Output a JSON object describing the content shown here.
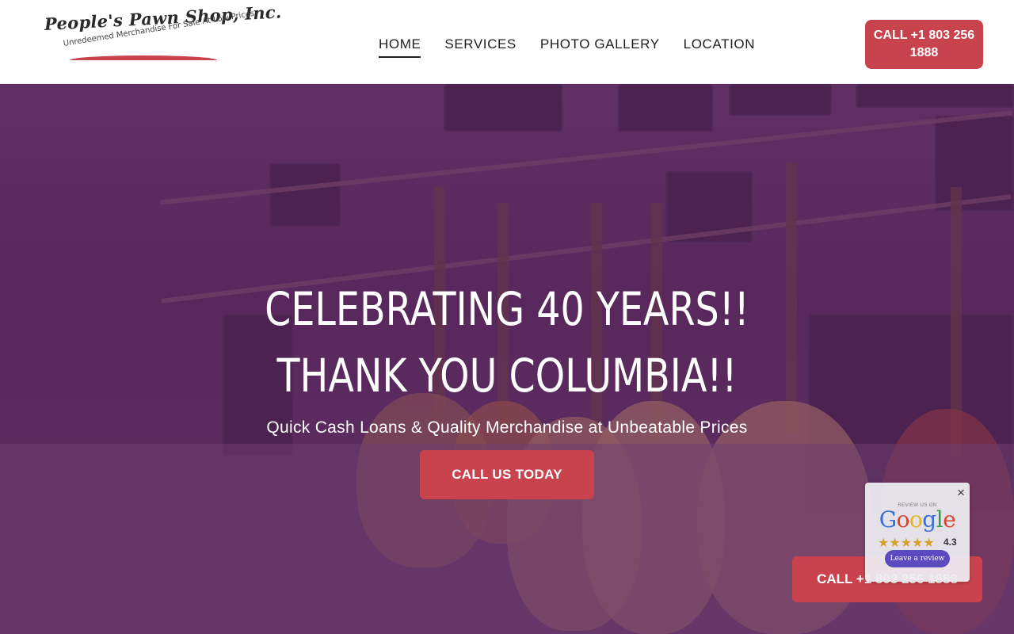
{
  "brand": {
    "name": "People's Pawn Shop, Inc.",
    "tagline": "Unredeemed Merchandise For Sale At Low Prices",
    "accent_color": "#c9434f"
  },
  "nav": {
    "items": [
      {
        "label": "HOME",
        "active": true
      },
      {
        "label": "SERVICES",
        "active": false
      },
      {
        "label": "PHOTO GALLERY",
        "active": false
      },
      {
        "label": "LOCATION",
        "active": false
      }
    ]
  },
  "header": {
    "cta_label": "CALL +1 803 256 1888"
  },
  "hero": {
    "title_line1": "CELEBRATING 40 YEARS!!",
    "title_line2": "THANK YOU COLUMBIA!!",
    "subtitle": "Quick Cash Loans & Quality Merchandise at Unbeatable Prices",
    "cta_label": "CALL US TODAY",
    "background_scene": "guitar-store-photo"
  },
  "floating_cta": {
    "label": "CALL +1 803 256 1888"
  },
  "review_widget": {
    "close_label": "×",
    "small_text": "REVIEW US ON",
    "brand": "Google",
    "stars": "★★★★★",
    "rating": "4.3",
    "button_label": "Leave a review"
  }
}
